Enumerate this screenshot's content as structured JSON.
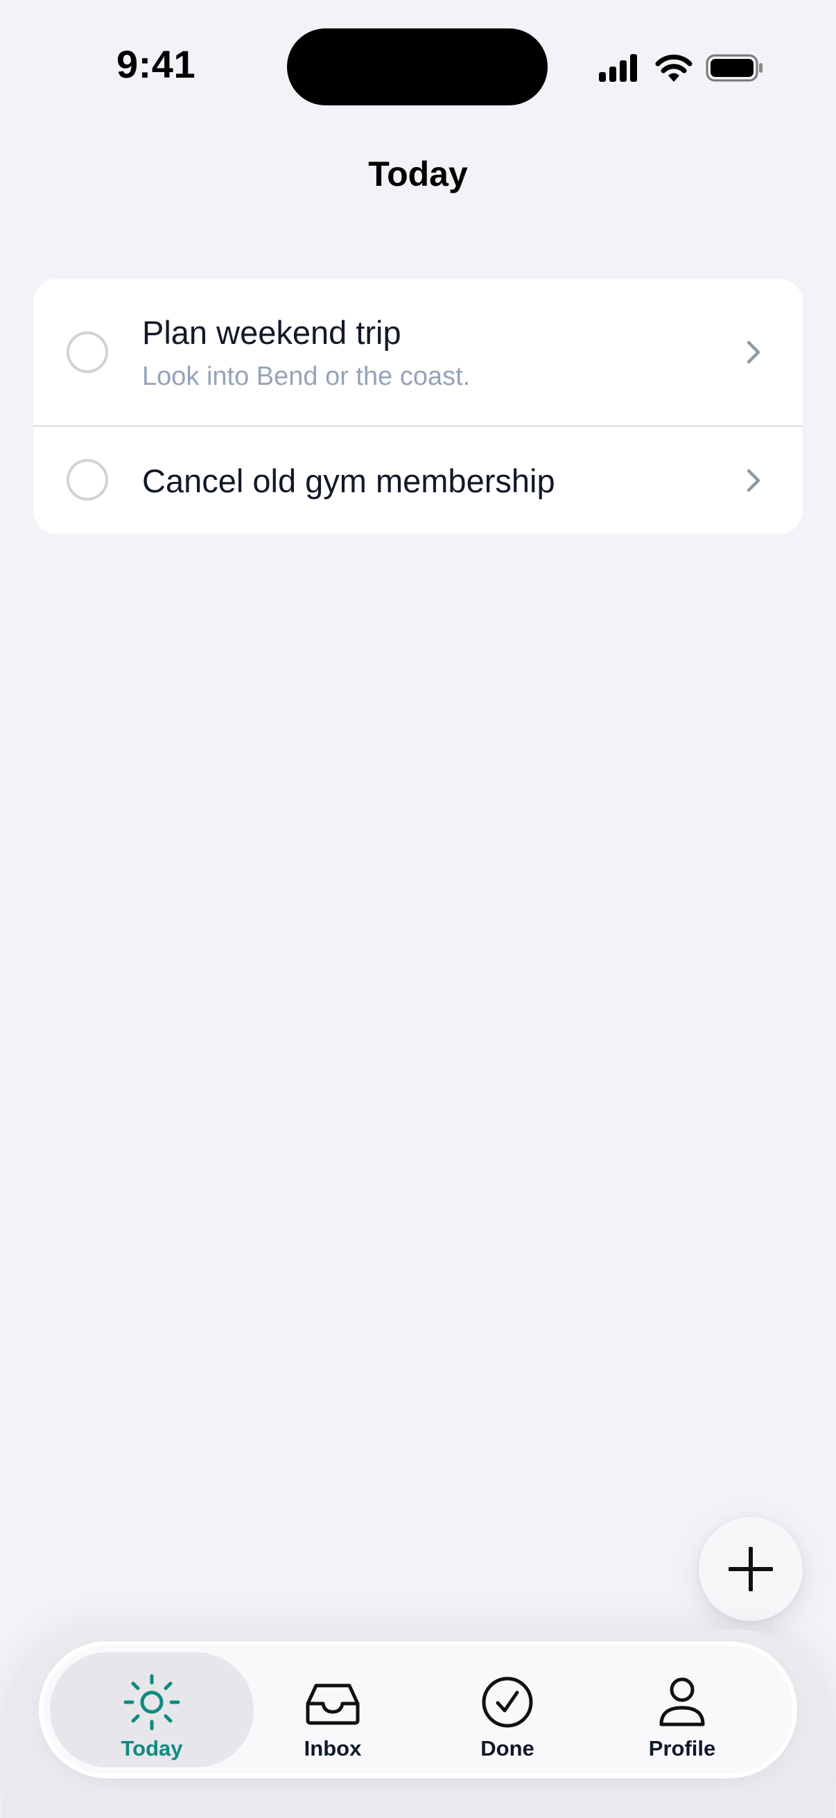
{
  "status_bar": {
    "time": "9:41",
    "icons": [
      "cellular-signal-icon",
      "wifi-icon",
      "battery-icon"
    ]
  },
  "header": {
    "title": "Today"
  },
  "tasks": [
    {
      "title": "Plan weekend trip",
      "note": "Look into Bend or the coast.",
      "completed": false
    },
    {
      "title": "Cancel old gym membership",
      "note": "",
      "completed": false
    }
  ],
  "fab": {
    "icon": "plus-icon"
  },
  "tab_bar": {
    "accent_color": "#0f8a80",
    "selected": "Today",
    "items": [
      {
        "label": "Today",
        "icon": "sun-icon"
      },
      {
        "label": "Inbox",
        "icon": "inbox-tray-icon"
      },
      {
        "label": "Done",
        "icon": "check-circle-icon"
      },
      {
        "label": "Profile",
        "icon": "person-icon"
      }
    ]
  }
}
